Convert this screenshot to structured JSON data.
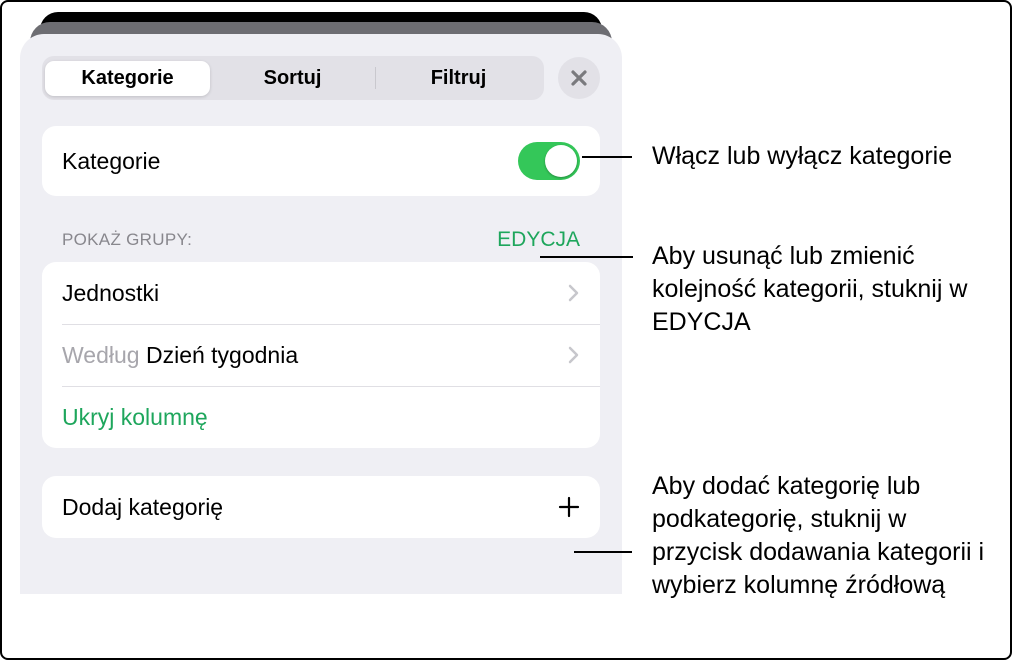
{
  "tabs": {
    "categories": "Kategorie",
    "sort": "Sortuj",
    "filter": "Filtruj"
  },
  "main_toggle": {
    "label": "Kategorie"
  },
  "groups": {
    "header": "POKAŻ GRUPY:",
    "edit": "EDYCJA",
    "items": [
      {
        "label": "Jednostki"
      },
      {
        "prefix": "Według ",
        "label": "Dzień tygodnia"
      }
    ],
    "hide_column": "Ukryj kolumnę"
  },
  "add_category": "Dodaj kategorię",
  "callouts": {
    "c1": "Włącz lub wyłącz kategorie",
    "c2": "Aby usunąć lub zmienić kolejność kategorii, stuknij w EDYCJA",
    "c3": "Aby dodać kategorię lub podkategorię, stuknij w przycisk dodawania kategorii i wybierz kolumnę źródłową"
  }
}
